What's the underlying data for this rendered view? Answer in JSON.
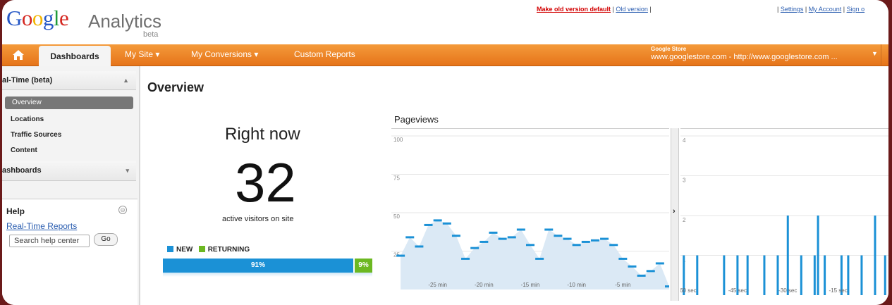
{
  "app": {
    "logo_parts": [
      "G",
      "o",
      "o",
      "g",
      "l",
      "e"
    ],
    "logo_word": "Analytics",
    "logo_sub": "beta"
  },
  "top_links": {
    "make_default": "Make old version default",
    "sep1": " | ",
    "old_version": "Old version",
    "sep2": " |",
    "right_prefix": "| ",
    "settings": "Settings",
    "my_account": "My Account",
    "sign_out": "Sign o"
  },
  "nav": {
    "home_icon": "home-icon",
    "dashboards": "Dashboards",
    "my_site": "My Site ▾",
    "my_conversions": "My Conversions ▾",
    "custom_reports": "Custom Reports",
    "account_name": "Google Store",
    "account_url": "www.googlestore.com - http://www.googlestore.com ...",
    "account_caret": "▼"
  },
  "sidebar": {
    "realtime_header": "al-Time (beta)",
    "realtime_chevron": "▲",
    "items": [
      "Overview",
      "Locations",
      "Traffic Sources",
      "Content"
    ],
    "dashboards_header": "ashboards",
    "dashboards_chevron": "▾",
    "help": {
      "title": "Help",
      "toggle": "⊖",
      "link": "Real-Time Reports",
      "search_placeholder": "Search help center",
      "go_label": "Go"
    }
  },
  "main": {
    "title": "Overview",
    "right_now_label": "Right now",
    "active_visitors": "32",
    "active_caption": "active visitors on site",
    "legend_new": "NEW",
    "legend_returning": "RETURNING",
    "new_pct": "91%",
    "returning_pct": "9%",
    "new_fraction": 0.91,
    "colors": {
      "new": "#1b91d6",
      "returning": "#6cb822",
      "line": "#1b91d6",
      "fill": "#dbe9f5"
    }
  },
  "chart_data": [
    {
      "type": "area",
      "title": "Pageviews",
      "xlabel": "",
      "ylabel": "",
      "ylim": [
        0,
        100
      ],
      "yticks": [
        100,
        75,
        50,
        25
      ],
      "ytick_labels": [
        "100",
        "75",
        "50",
        "25"
      ],
      "xticks": [
        -25,
        -20,
        -15,
        -10,
        -5
      ],
      "xtick_labels": [
        "-25 min",
        "-20 min",
        "-15 min",
        "-10 min",
        "-5 min"
      ],
      "xlim": [
        -30,
        0
      ],
      "series": [
        {
          "x": [
            -29,
            -28,
            -27,
            -26,
            -25,
            -24,
            -23,
            -22,
            -21,
            -20,
            -19,
            -18,
            -17,
            -16,
            -15,
            -14,
            -13,
            -12,
            -11,
            -10,
            -9,
            -8,
            -7,
            -6,
            -5,
            -4,
            -3,
            -2,
            -1,
            0
          ],
          "values": [
            22,
            34,
            28,
            42,
            45,
            43,
            35,
            20,
            27,
            31,
            37,
            33,
            34,
            39,
            29,
            20,
            39,
            35,
            33,
            29,
            31,
            32,
            33,
            29,
            20,
            15,
            9,
            12,
            17,
            2
          ]
        }
      ],
      "grid": true
    },
    {
      "type": "bar",
      "title": "",
      "ylim": [
        0,
        4
      ],
      "yticks": [
        4,
        3,
        2,
        1
      ],
      "ytick_labels": [
        "4",
        "3",
        "2",
        "1"
      ],
      "xticks": [
        -60,
        -45,
        -30,
        -15
      ],
      "xtick_labels": [
        "-60 sec",
        "-45 sec",
        "-30 sec",
        "-15 sec"
      ],
      "xlim": [
        -62,
        0
      ],
      "series": [
        {
          "x": [
            -61,
            -57,
            -49,
            -45,
            -42,
            -37,
            -33,
            -30,
            -26,
            -22,
            -21,
            -19,
            -14,
            -12,
            -8,
            -4,
            -1
          ],
          "values": [
            1,
            1,
            1,
            1,
            1,
            1,
            1,
            2,
            1,
            1,
            2,
            1,
            1,
            1,
            1,
            2,
            1
          ]
        }
      ],
      "grid": true
    }
  ]
}
